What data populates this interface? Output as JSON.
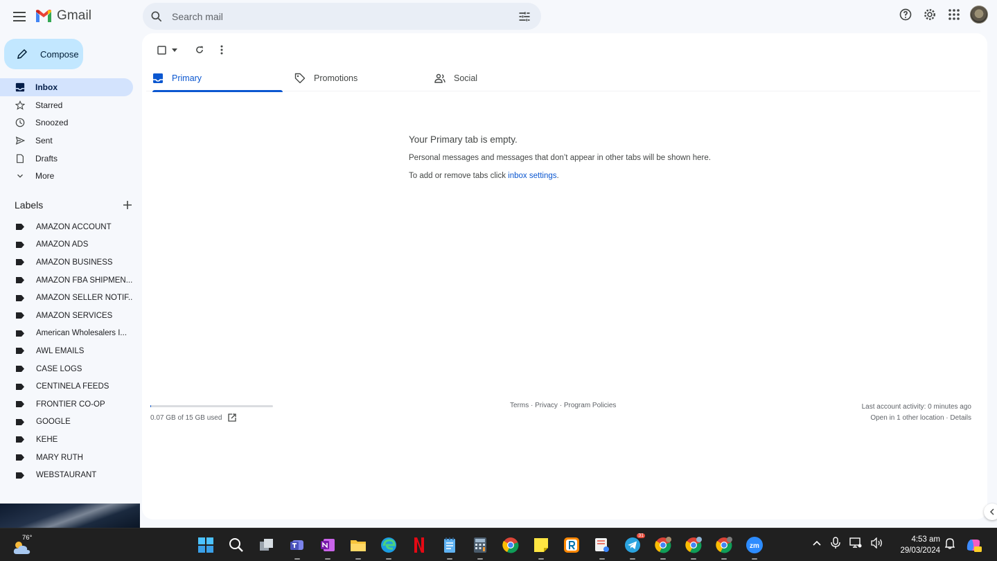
{
  "app": {
    "name": "Gmail"
  },
  "search": {
    "placeholder": "Search mail"
  },
  "compose": {
    "label": "Compose"
  },
  "nav": [
    {
      "label": "Inbox",
      "icon": "inbox-icon",
      "active": true
    },
    {
      "label": "Starred",
      "icon": "star-icon"
    },
    {
      "label": "Snoozed",
      "icon": "clock-icon"
    },
    {
      "label": "Sent",
      "icon": "send-icon"
    },
    {
      "label": "Drafts",
      "icon": "draft-icon"
    },
    {
      "label": "More",
      "icon": "chevron-down-icon"
    }
  ],
  "labels": {
    "title": "Labels",
    "items": [
      "AMAZON ACCOUNT",
      "AMAZON ADS",
      "AMAZON BUSINESS",
      "AMAZON FBA SHIPMEN...",
      "AMAZON SELLER NOTIF...",
      "AMAZON SERVICES",
      "American Wholesalers I...",
      "AWL EMAILS",
      "CASE LOGS",
      "CENTINELA FEEDS",
      "FRONTIER CO-OP",
      "GOOGLE",
      "KEHE",
      "MARY RUTH",
      "WEBSTAURANT"
    ]
  },
  "tabs": [
    {
      "label": "Primary",
      "active": true
    },
    {
      "label": "Promotions"
    },
    {
      "label": "Social"
    }
  ],
  "empty_state": {
    "title": "Your Primary tab is empty.",
    "line1": "Personal messages and messages that don’t appear in other tabs will be shown here.",
    "line2_prefix": "To add or remove tabs click ",
    "line2_link": "inbox settings",
    "line2_suffix": "."
  },
  "footer": {
    "storage": "0.07 GB of 15 GB used",
    "storage_fraction": 0.005,
    "terms": "Terms",
    "privacy": "Privacy",
    "policies": "Program Policies",
    "sep": " · ",
    "activity": "Last account activity: 0 minutes ago",
    "open_in": "Open in 1 other location",
    "details": "Details"
  },
  "taskbar": {
    "temperature": "76°",
    "time": "4:53 am",
    "date": "29/03/2024",
    "telegram_badge": "31"
  },
  "colors": {
    "accent": "#0b57d0",
    "compose_bg": "#c2e7ff",
    "active_nav": "#d3e3fd",
    "search_bg": "#e9eef6"
  }
}
